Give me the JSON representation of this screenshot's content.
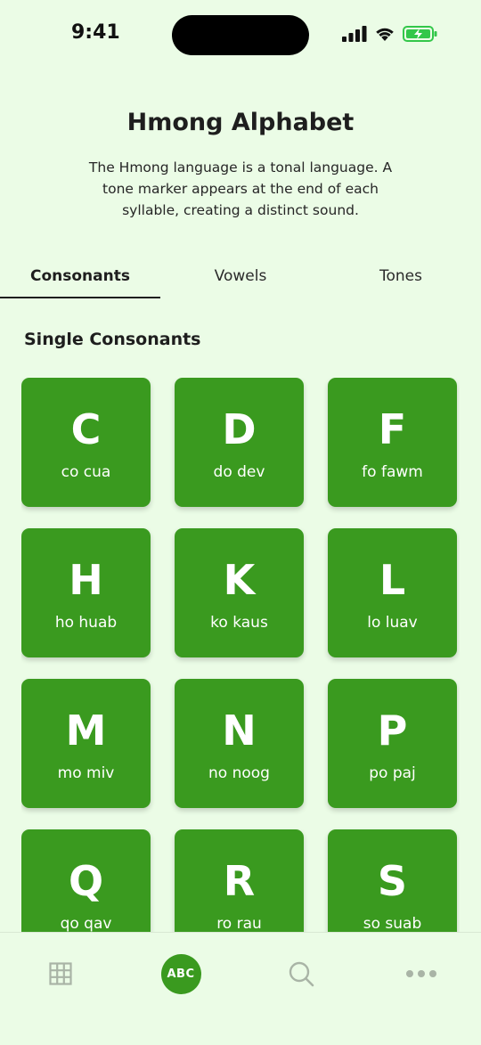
{
  "status_bar": {
    "time": "9:41",
    "icons": [
      "signal-icon",
      "wifi-icon",
      "battery-charging-icon"
    ]
  },
  "header": {
    "title": "Hmong Alphabet",
    "description": "The Hmong language is a tonal language. A tone marker appears at the end of each syllable, creating a distinct sound."
  },
  "tabs": [
    {
      "label": "Consonants",
      "active": true
    },
    {
      "label": "Vowels",
      "active": false
    },
    {
      "label": "Tones",
      "active": false
    }
  ],
  "section": {
    "title": "Single Consonants"
  },
  "consonants": [
    {
      "letter": "C",
      "word": "co cua"
    },
    {
      "letter": "D",
      "word": "do dev"
    },
    {
      "letter": "F",
      "word": "fo fawm"
    },
    {
      "letter": "H",
      "word": "ho huab"
    },
    {
      "letter": "K",
      "word": "ko kaus"
    },
    {
      "letter": "L",
      "word": "lo luav"
    },
    {
      "letter": "M",
      "word": "mo miv"
    },
    {
      "letter": "N",
      "word": "no noog"
    },
    {
      "letter": "P",
      "word": "po paj"
    },
    {
      "letter": "Q",
      "word": "qo qav"
    },
    {
      "letter": "R",
      "word": "ro rau"
    },
    {
      "letter": "S",
      "word": "so suab"
    }
  ],
  "bottom_nav": {
    "items": [
      {
        "icon": "grid-icon",
        "active": false
      },
      {
        "icon": "abc-icon",
        "label": "ABC",
        "active": true
      },
      {
        "icon": "search-icon",
        "active": false
      },
      {
        "icon": "more-icon",
        "active": false
      }
    ]
  },
  "colors": {
    "background": "#ebfce6",
    "accent": "#3a9a1f",
    "inactive_icon": "#a9b4a6",
    "battery": "#33c74a"
  }
}
